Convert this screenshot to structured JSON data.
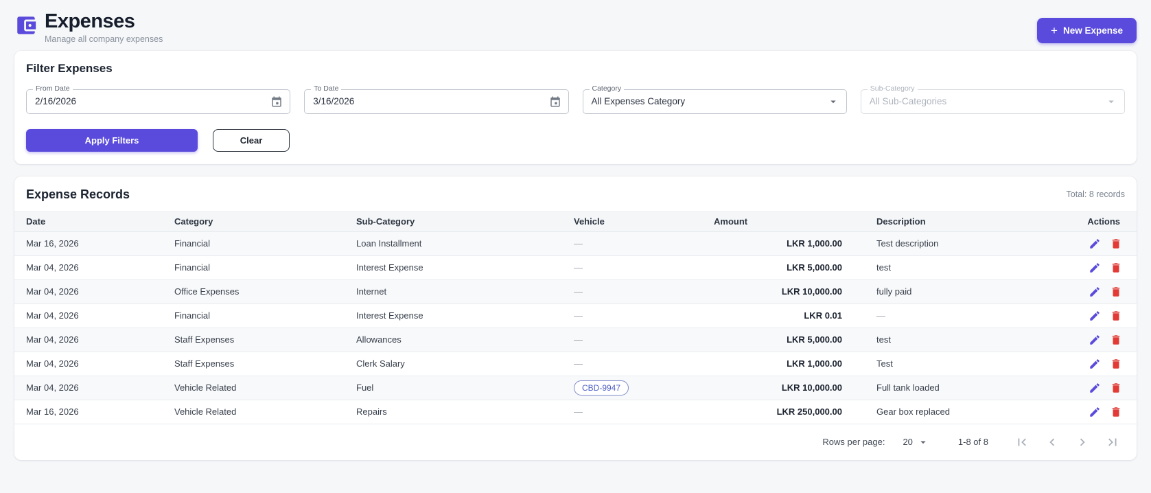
{
  "header": {
    "title": "Expenses",
    "subtitle": "Manage all company expenses",
    "new_expense_button": "New Expense",
    "plus_icon": "+"
  },
  "filter": {
    "title": "Filter Expenses",
    "from_date": {
      "label": "From Date",
      "value": "2/16/2026"
    },
    "to_date": {
      "label": "To Date",
      "value": "3/16/2026"
    },
    "category": {
      "label": "Category",
      "value": "All Expenses Category"
    },
    "sub_category": {
      "label": "Sub-Category",
      "value": "All Sub-Categories"
    },
    "apply_button": "Apply Filters",
    "clear_button": "Clear"
  },
  "records": {
    "title": "Expense Records",
    "total": "Total: 8 records",
    "columns": [
      "Date",
      "Category",
      "Sub-Category",
      "Vehicle",
      "Amount",
      "Description",
      "Actions"
    ],
    "rows": [
      {
        "date": "Mar 16, 2026",
        "category": "Financial",
        "sub_category": "Loan Installment",
        "vehicle": "—",
        "vehicle_chip": false,
        "amount": "LKR 1,000.00",
        "description": "Test description"
      },
      {
        "date": "Mar 04, 2026",
        "category": "Financial",
        "sub_category": "Interest Expense",
        "vehicle": "—",
        "vehicle_chip": false,
        "amount": "LKR 5,000.00",
        "description": "test"
      },
      {
        "date": "Mar 04, 2026",
        "category": "Office Expenses",
        "sub_category": "Internet",
        "vehicle": "—",
        "vehicle_chip": false,
        "amount": "LKR 10,000.00",
        "description": "fully paid"
      },
      {
        "date": "Mar 04, 2026",
        "category": "Financial",
        "sub_category": "Interest Expense",
        "vehicle": "—",
        "vehicle_chip": false,
        "amount": "LKR 0.01",
        "description": "—"
      },
      {
        "date": "Mar 04, 2026",
        "category": "Staff Expenses",
        "sub_category": "Allowances",
        "vehicle": "—",
        "vehicle_chip": false,
        "amount": "LKR 5,000.00",
        "description": "test"
      },
      {
        "date": "Mar 04, 2026",
        "category": "Staff Expenses",
        "sub_category": "Clerk Salary",
        "vehicle": "—",
        "vehicle_chip": false,
        "amount": "LKR 1,000.00",
        "description": "Test"
      },
      {
        "date": "Mar 04, 2026",
        "category": "Vehicle Related",
        "sub_category": "Fuel",
        "vehicle": "CBD-9947",
        "vehicle_chip": true,
        "amount": "LKR 10,000.00",
        "description": "Full tank loaded"
      },
      {
        "date": "Mar 16, 2026",
        "category": "Vehicle Related",
        "sub_category": "Repairs",
        "vehicle": "—",
        "vehicle_chip": false,
        "amount": "LKR 250,000.00",
        "description": "Gear box replaced"
      }
    ],
    "pagination": {
      "rows_per_page_label": "Rows per page:",
      "rows_per_page_value": "20",
      "range": "1-8 of 8"
    }
  },
  "colors": {
    "accent": "#5a4bdc",
    "delete_red": "#e23b36",
    "chip_indigo": "#5060c4",
    "page_bg": "#f6f7f9"
  }
}
